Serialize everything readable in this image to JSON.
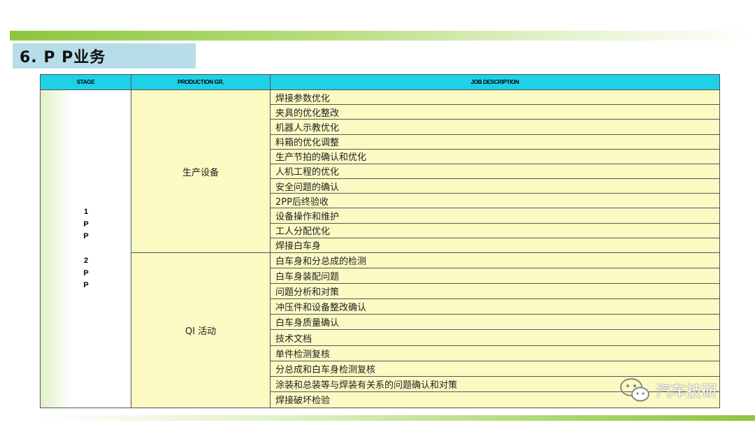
{
  "slide": {
    "title": "6. P P业务"
  },
  "table": {
    "headers": [
      "STAGE",
      "PRODUCTION GR.",
      "JOB DESCRIPTION"
    ],
    "stage": "1\nP\nP\n\n2\nP\nP",
    "groups": [
      {
        "name": "生产设备",
        "jobs": [
          "焊接参数优化",
          "夹具的优化整改",
          "机器人示教优化",
          "料箱的优化调整",
          "生产节拍的确认和优化",
          "人机工程的优化",
          "安全问题的确认",
          "2PP后终验收",
          "设备操作和维护",
          "工人分配优化",
          "焊接白车身"
        ]
      },
      {
        "name": "QI 活动",
        "jobs": [
          "白车身和分总成的检测",
          "白车身装配问题",
          "问题分析和对策",
          "冲压件和设备整改确认",
          "白车身质量确认",
          "技术文档",
          "单件检测复核",
          "分总成和白车身检测复核",
          "涂装和总装等与焊装有关系的问题确认和对策",
          "焊接破坏检验"
        ]
      }
    ]
  },
  "watermark": {
    "text": "汽车技研",
    "icon": "wechat-icon"
  },
  "colors": {
    "header_bg": "#1fd1e6",
    "cell_bg": "#fbfac3",
    "title_bg": "#b7dde8",
    "accent_green": "#8dc63f"
  }
}
